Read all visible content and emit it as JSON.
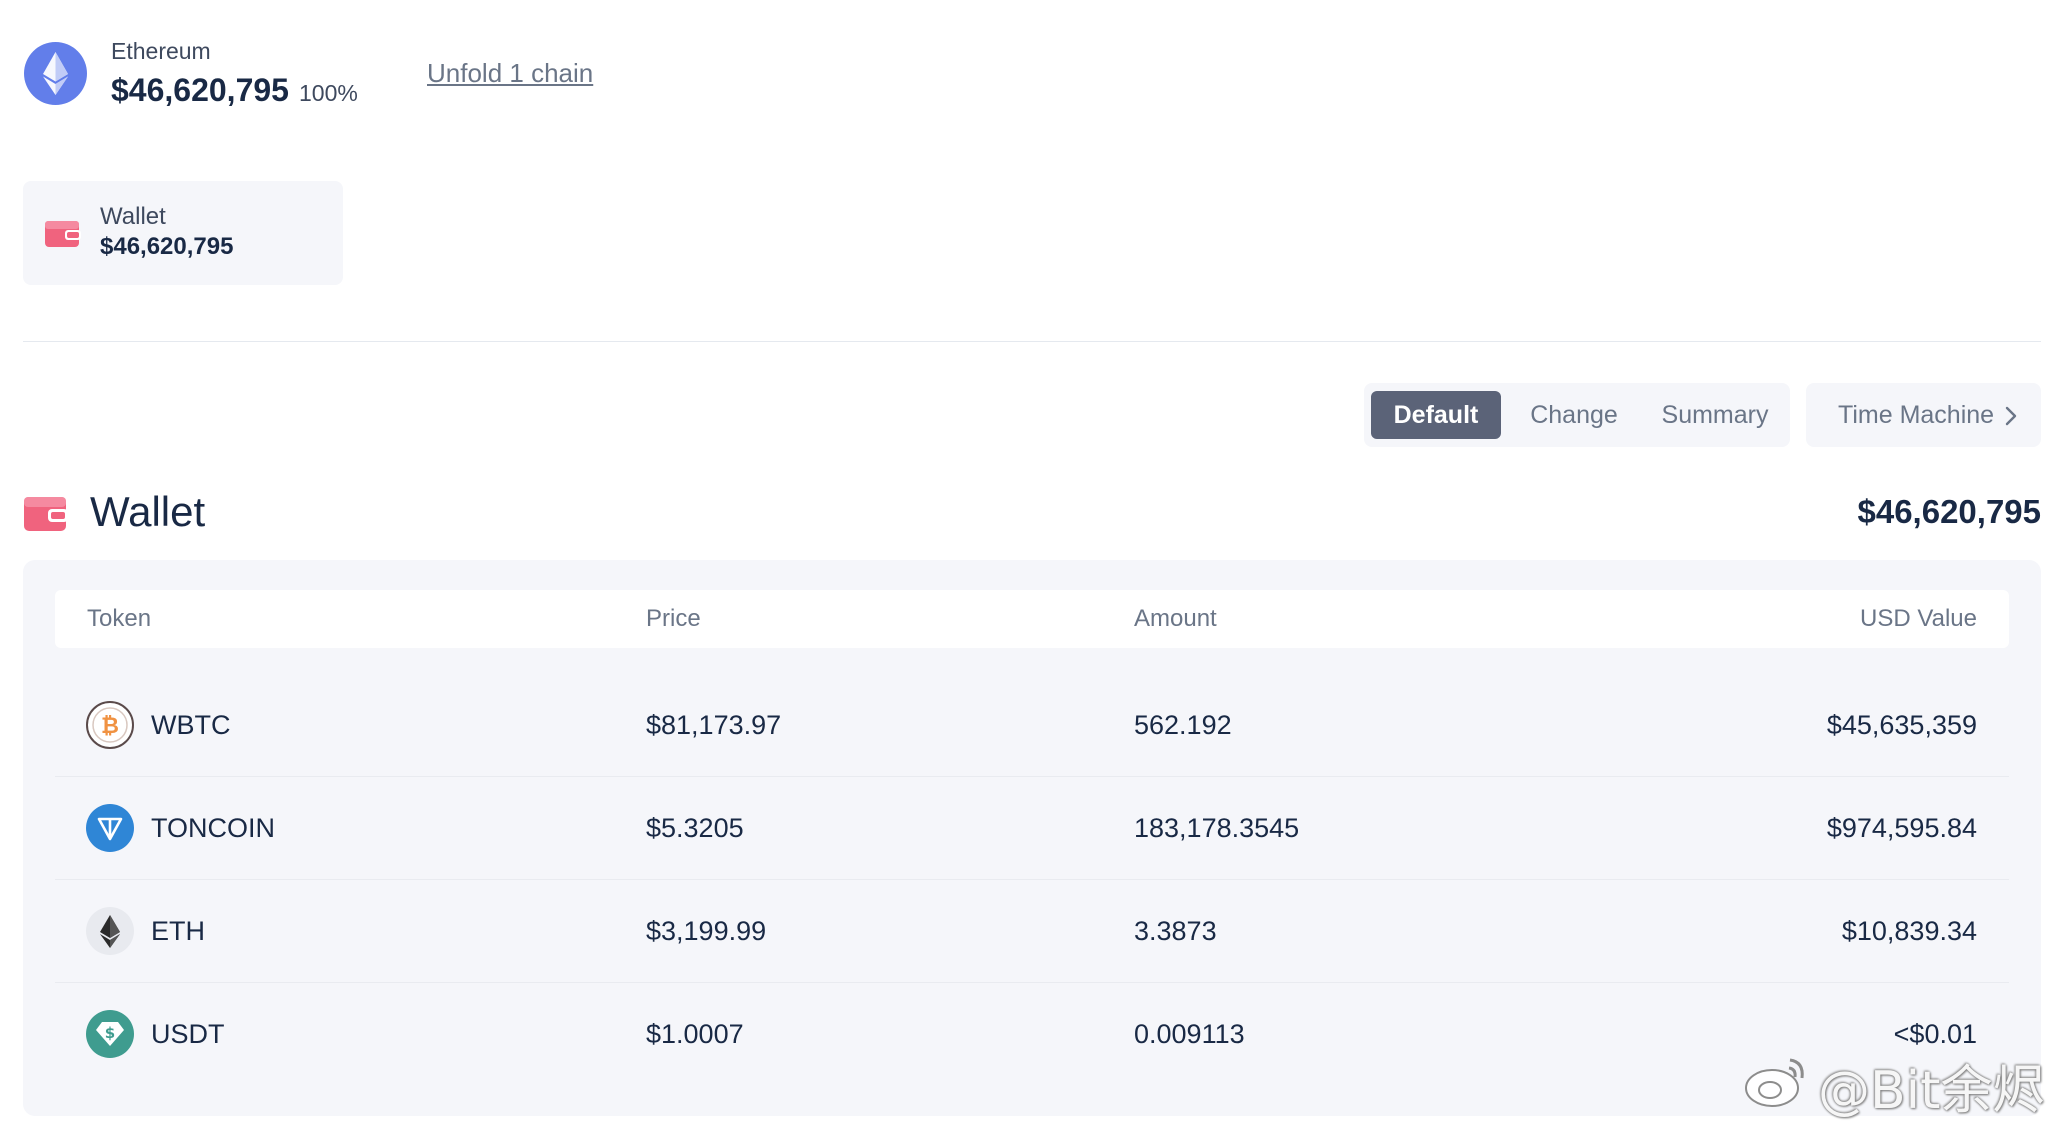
{
  "chain": {
    "name": "Ethereum",
    "value": "$46,620,795",
    "percent": "100%",
    "unfold_label": "Unfold 1 chain",
    "icon": "ethereum-icon",
    "color": "#627eea"
  },
  "wallet_card": {
    "label": "Wallet",
    "value": "$46,620,795",
    "icon": "wallet-icon"
  },
  "views": {
    "tabs": [
      {
        "label": "Default",
        "active": true
      },
      {
        "label": "Change",
        "active": false
      },
      {
        "label": "Summary",
        "active": false
      }
    ],
    "time_machine_label": "Time Machine"
  },
  "section": {
    "title": "Wallet",
    "total": "$46,620,795",
    "icon": "wallet-icon",
    "accent": "#f0637e"
  },
  "table": {
    "columns": [
      "Token",
      "Price",
      "Amount",
      "USD Value"
    ],
    "rows": [
      {
        "token": "WBTC",
        "price": "$81,173.97",
        "amount": "562.192",
        "usd_value": "$45,635,359",
        "icon": "wbtc-icon"
      },
      {
        "token": "TONCOIN",
        "price": "$5.3205",
        "amount": "183,178.3545",
        "usd_value": "$974,595.84",
        "icon": "toncoin-icon"
      },
      {
        "token": "ETH",
        "price": "$3,199.99",
        "amount": "3.3873",
        "usd_value": "$10,839.34",
        "icon": "eth-icon"
      },
      {
        "token": "USDT",
        "price": "$1.0007",
        "amount": "0.009113",
        "usd_value": "<$0.01",
        "icon": "usdt-icon"
      }
    ]
  },
  "watermark": {
    "text": "@Bit余烬"
  }
}
